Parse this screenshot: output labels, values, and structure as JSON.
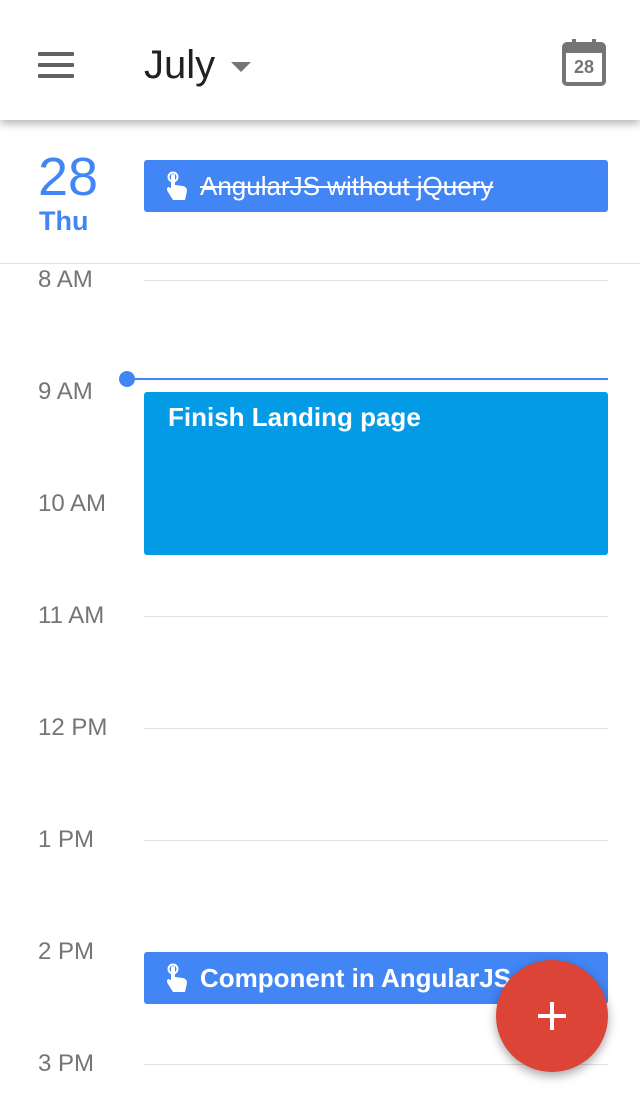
{
  "header": {
    "month": "July",
    "today_day": "28",
    "icons": {
      "menu": "menu-icon",
      "dropdown": "arrow-drop-down-icon",
      "today": "calendar-today-icon"
    }
  },
  "day": {
    "number": "28",
    "weekday": "Thu"
  },
  "all_day_events": [
    {
      "title": "AngularJS without jQuery",
      "icon": "touch-icon",
      "completed": true
    }
  ],
  "hours": [
    "8 AM",
    "9 AM",
    "10 AM",
    "11 AM",
    "12 PM",
    "1 PM",
    "2 PM",
    "3 PM"
  ],
  "events": [
    {
      "title": "Finish Landing page"
    },
    {
      "title": "Component in AngularJS 2",
      "icon": "touch-icon"
    }
  ],
  "fab": {
    "icon": "add-icon"
  },
  "colors": {
    "accent": "#4285f4",
    "event": "#039be5",
    "fab": "#db4437",
    "text_primary": "#212121",
    "text_secondary": "#757575",
    "divider": "#e0e0e0"
  }
}
